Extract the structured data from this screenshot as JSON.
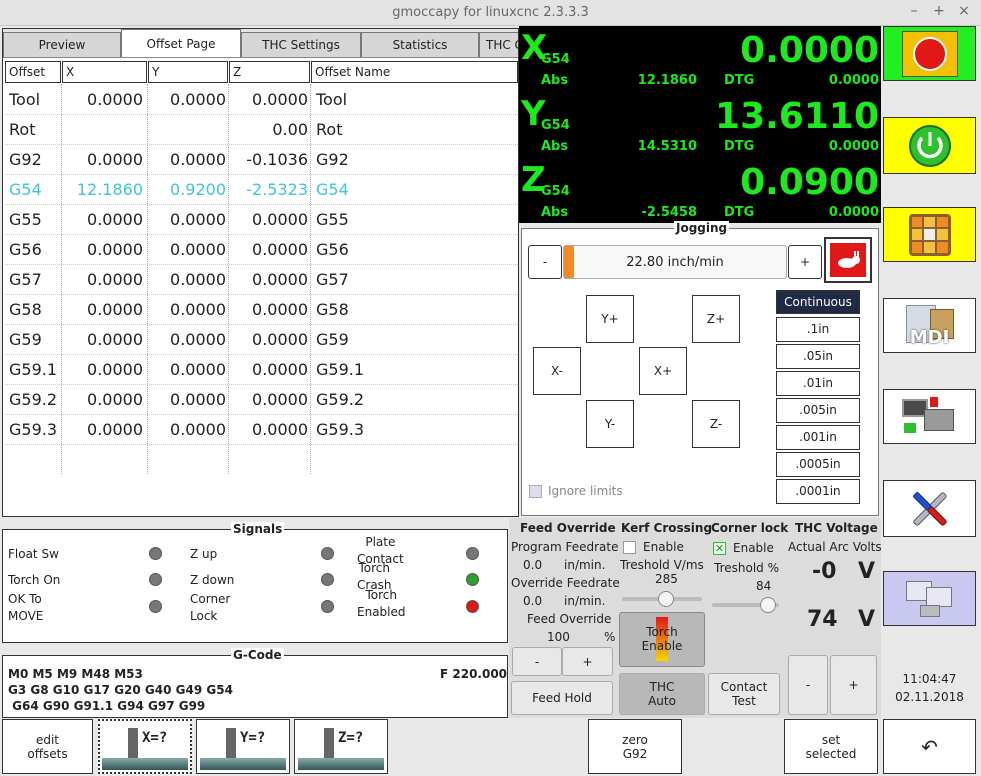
{
  "window": {
    "title": "gmoccapy for linuxcnc  2.3.3.3"
  },
  "tabs": [
    {
      "label": "Preview"
    },
    {
      "label": "Offset Page"
    },
    {
      "label": "THC Settings"
    },
    {
      "label": "Statistics"
    },
    {
      "label": "THC G"
    }
  ],
  "offsets": {
    "headers": [
      "Offset",
      "X",
      "Y",
      "Z",
      "Offset Name"
    ],
    "rows": [
      {
        "offset": "Tool",
        "x": "0.0000",
        "y": "0.0000",
        "z": "0.0000",
        "name": "Tool"
      },
      {
        "offset": "Rot",
        "x": "",
        "y": "",
        "z": "0.00",
        "name": "Rot"
      },
      {
        "offset": "G92",
        "x": "0.0000",
        "y": "0.0000",
        "z": "-0.1036",
        "name": "G92"
      },
      {
        "offset": "G54",
        "x": "12.1860",
        "y": "0.9200",
        "z": "-2.5323",
        "name": "G54"
      },
      {
        "offset": "G55",
        "x": "0.0000",
        "y": "0.0000",
        "z": "0.0000",
        "name": "G55"
      },
      {
        "offset": "G56",
        "x": "0.0000",
        "y": "0.0000",
        "z": "0.0000",
        "name": "G56"
      },
      {
        "offset": "G57",
        "x": "0.0000",
        "y": "0.0000",
        "z": "0.0000",
        "name": "G57"
      },
      {
        "offset": "G58",
        "x": "0.0000",
        "y": "0.0000",
        "z": "0.0000",
        "name": "G58"
      },
      {
        "offset": "G59",
        "x": "0.0000",
        "y": "0.0000",
        "z": "0.0000",
        "name": "G59"
      },
      {
        "offset": "G59.1",
        "x": "0.0000",
        "y": "0.0000",
        "z": "0.0000",
        "name": "G59.1"
      },
      {
        "offset": "G59.2",
        "x": "0.0000",
        "y": "0.0000",
        "z": "0.0000",
        "name": "G59.2"
      },
      {
        "offset": "G59.3",
        "x": "0.0000",
        "y": "0.0000",
        "z": "0.0000",
        "name": "G59.3"
      }
    ]
  },
  "dro": {
    "x": {
      "axis": "X",
      "system": "G54",
      "value": "0.0000",
      "abs_label": "Abs",
      "abs": "12.1860",
      "dtg_label": "DTG",
      "dtg": "0.0000"
    },
    "y": {
      "axis": "Y",
      "system": "G54",
      "value": "13.6110",
      "abs_label": "Abs",
      "abs": "14.5310",
      "dtg_label": "DTG",
      "dtg": "0.0000"
    },
    "z": {
      "axis": "Z",
      "system": "G54",
      "value": "0.0900",
      "abs_label": "Abs",
      "abs": "-2.5458",
      "dtg_label": "DTG",
      "dtg": "0.0000"
    }
  },
  "jogging": {
    "title": "Jogging",
    "minus": "-",
    "plus": "+",
    "speed": "22.80 inch/min",
    "buttons": {
      "y_plus": "Y+",
      "z_plus": "Z+",
      "x_minus": "X-",
      "x_plus": "X+",
      "y_minus": "Y-",
      "z_minus": "Z-"
    },
    "increments": [
      "Continuous",
      ".1in",
      ".05in",
      ".01in",
      ".005in",
      ".001in",
      ".0005in",
      ".0001in"
    ],
    "ignore_limits": "Ignore limits"
  },
  "signals": {
    "title": "Signals",
    "items": [
      {
        "label": "Float Sw",
        "color": "#777777"
      },
      {
        "label": "Torch On",
        "color": "#777777"
      },
      {
        "label": "OK To\nMOVE",
        "color": "#777777"
      },
      {
        "label": "Z up",
        "color": "#777777"
      },
      {
        "label": "Z down",
        "color": "#777777"
      },
      {
        "label": "Corner\nLock",
        "color": "#777777"
      },
      {
        "label": "Plate\nContact",
        "color": "#777777"
      },
      {
        "label": "Torch\nCrash",
        "color": "#2e9e2e"
      },
      {
        "label": "Torch\nEnabled",
        "color": "#e01818"
      }
    ]
  },
  "gcode": {
    "title": "G-Code",
    "line1": "M0 M5 M9 M48 M53",
    "feed": "F  220.000",
    "line2": "G3 G8 G10 G17 G20 G40 G49 G54",
    "line3": " G64 G90 G91.1 G94 G97 G99"
  },
  "feed_override": {
    "title": "Feed Override",
    "program_label": "Program Feedrate",
    "program_value": "0.0",
    "program_unit": "in/min.",
    "override_label": "Override Feedrate",
    "override_value": "0.0",
    "override_unit": "in/min.",
    "percent_label": "Feed Override",
    "percent_value": "100",
    "percent_unit": "%",
    "minus": "-",
    "plus": "+",
    "hold": "Feed Hold"
  },
  "kerf": {
    "title": "Kerf Crossing",
    "enable": "Enable",
    "threshold_label": "Treshold  V/ms",
    "threshold_value": "285",
    "slider_fraction": 0.55,
    "torch_enable": "Torch\nEnable",
    "thc_auto": "THC\nAuto"
  },
  "corner": {
    "title": "Corner lock",
    "enable": "Enable",
    "threshold_label": "Treshold %",
    "threshold_value": "84",
    "slider_fraction": 0.84,
    "contact_test": "Contact\nTest"
  },
  "thc_voltage": {
    "title": "THC Voltage",
    "actual_label": "Actual Arc Volts",
    "actual_value": "-0",
    "actual_unit": "V",
    "target_value": "74",
    "target_unit": "V",
    "minus": "-",
    "plus": "+"
  },
  "clock": {
    "time": "11:04:47",
    "date": "02.11.2018"
  },
  "bottom": {
    "edit_offsets": "edit\noffsets",
    "x_set": "X=?",
    "y_set": "Y=?",
    "z_set": "Z=?",
    "zero_g92": "zero\nG92",
    "set_selected": "set\nselected"
  },
  "side": {
    "mdi": "MDI"
  },
  "colors": {
    "dro_bg": "#000000",
    "dro_fg": "#1ee81e",
    "highlight_row": "#3fc6cf",
    "estop_bg": "#22ee22",
    "power_bg": "#ffff00"
  }
}
